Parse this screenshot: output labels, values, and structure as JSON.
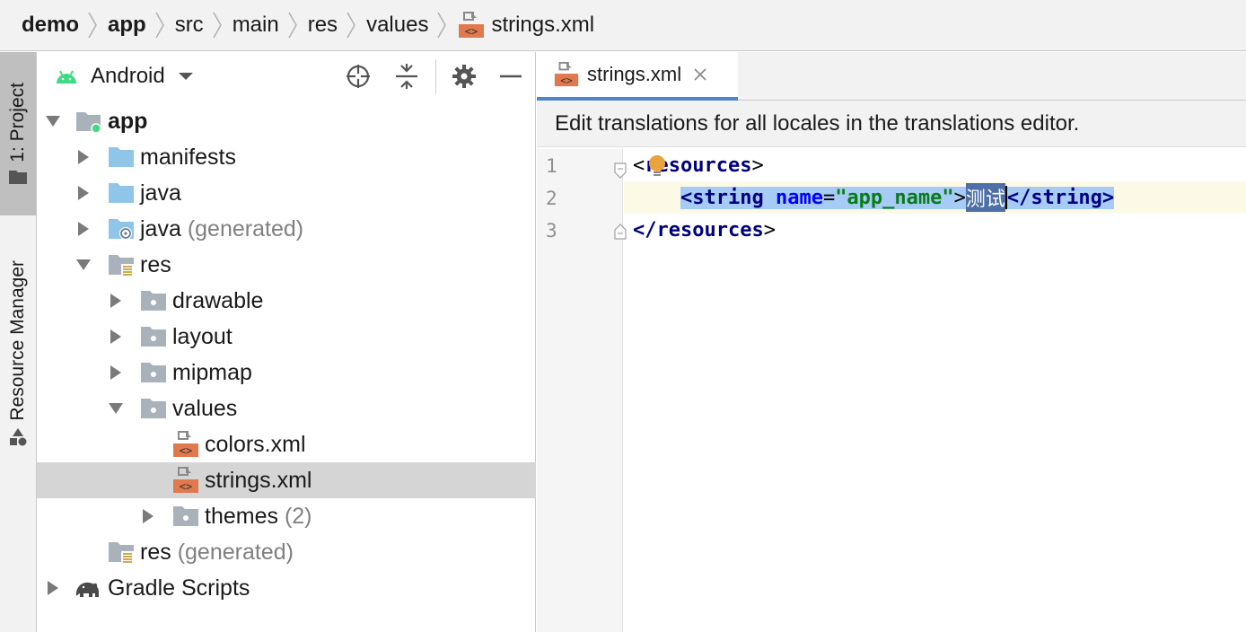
{
  "breadcrumb": {
    "items": [
      "demo",
      "app",
      "src",
      "main",
      "res",
      "values",
      "strings.xml"
    ]
  },
  "tool_strip": {
    "project_tab": "1: Project",
    "resource_manager_tab": "Resource Manager"
  },
  "project_panel": {
    "view_mode": "Android",
    "tree": [
      {
        "label": "app",
        "suffix": ""
      },
      {
        "label": "manifests",
        "suffix": ""
      },
      {
        "label": "java",
        "suffix": ""
      },
      {
        "label": "java",
        "suffix": "(generated)"
      },
      {
        "label": "res",
        "suffix": ""
      },
      {
        "label": "drawable",
        "suffix": ""
      },
      {
        "label": "layout",
        "suffix": ""
      },
      {
        "label": "mipmap",
        "suffix": ""
      },
      {
        "label": "values",
        "suffix": ""
      },
      {
        "label": "colors.xml",
        "suffix": ""
      },
      {
        "label": "strings.xml",
        "suffix": ""
      },
      {
        "label": "themes",
        "suffix": "(2)"
      },
      {
        "label": "res",
        "suffix": "(generated)"
      },
      {
        "label": "Gradle Scripts",
        "suffix": ""
      }
    ]
  },
  "editor": {
    "tab_label": "strings.xml",
    "banner": "Edit translations for all locales in the translations editor.",
    "line_numbers": [
      "1",
      "2",
      "3"
    ],
    "code": {
      "l1_open": "<",
      "l1_tag": "resources",
      "l1_close": ">",
      "l2_indent": "    ",
      "l2_open": "<string",
      "l2_attr": "name",
      "l2_eq": "=",
      "l2_val": "\"app_name\"",
      "l2_gt": ">",
      "l2_text": "测试",
      "l2_end_open": "</",
      "l2_end_tag": "string",
      "l2_end_close": ">",
      "l3_open": "</",
      "l3_tag": "resources",
      "l3_close": ">"
    }
  },
  "colors": {
    "accent_tab_underline": "#4a86c8",
    "selection": "#a6cbf5",
    "bulb": "#e8a33a",
    "xml_icon": "#e07a4e"
  }
}
